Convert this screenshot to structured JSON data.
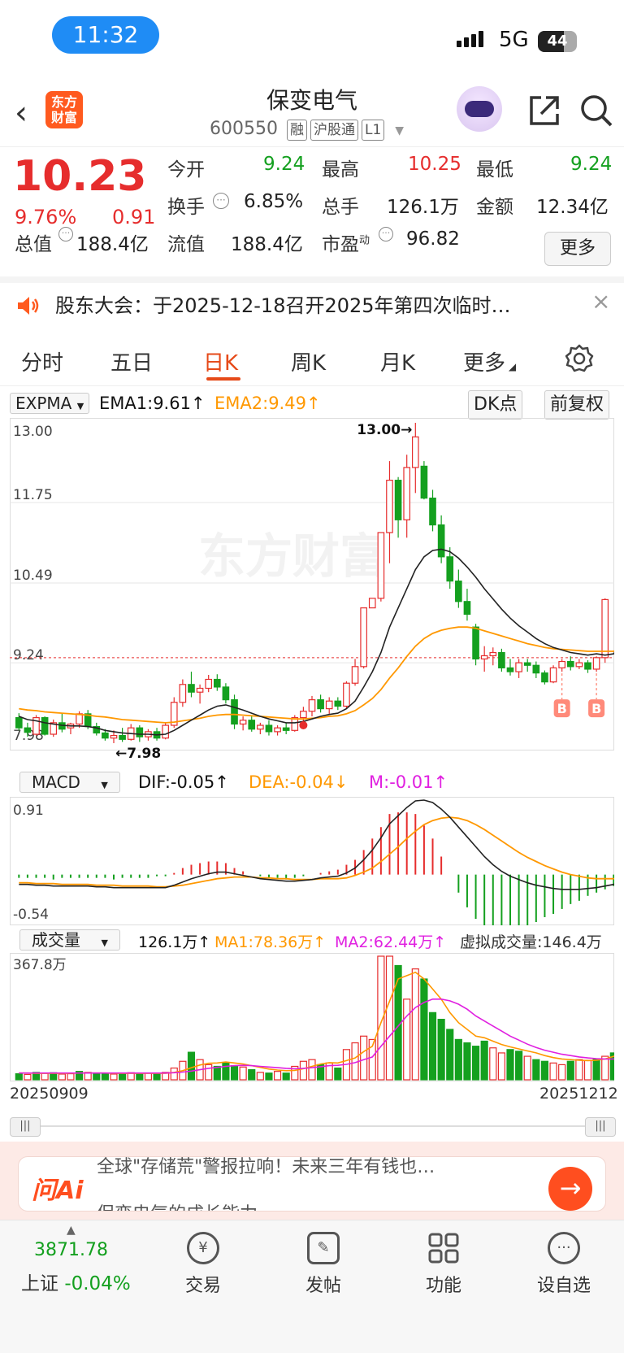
{
  "status": {
    "time": "11:32",
    "network": "5G",
    "battery": "44"
  },
  "header": {
    "stock_name": "保变电气",
    "stock_code": "600550",
    "tags": [
      "融",
      "沪股通",
      "L1"
    ],
    "logo_text": "东方财富"
  },
  "quote": {
    "price": "10.23",
    "pct_change": "9.76%",
    "change": "0.91",
    "open_label": "今开",
    "open": "9.24",
    "high_label": "最高",
    "high": "10.25",
    "low_label": "最低",
    "low": "9.24",
    "turnover_label": "换手",
    "turnover": "6.85%",
    "volume_label": "总手",
    "volume": "126.1万",
    "amount_label": "金额",
    "amount": "12.34亿",
    "total_cap_label": "总值",
    "total_cap": "188.4亿",
    "float_cap_label": "流值",
    "float_cap": "188.4亿",
    "pe_label": "市盈",
    "pe_sup": "动",
    "pe": "96.82",
    "more_label": "更多"
  },
  "notice": {
    "text": "股东大会：于2025-12-18召开2025年第四次临时…"
  },
  "tabs": [
    "分时",
    "五日",
    "日K",
    "周K",
    "月K",
    "更多"
  ],
  "active_tab": "日K",
  "main_indicator": {
    "name": "EXPMA",
    "ema1": "EMA1:9.61",
    "ema2": "EMA2:9.49",
    "dk_label": "DK点",
    "adjust_label": "前复权"
  },
  "macd_indicator": {
    "name": "MACD",
    "dif": "DIF:-0.05",
    "dea": "DEA:-0.04",
    "m": "M:-0.01"
  },
  "vol_indicator": {
    "name": "成交量",
    "vol": "126.1万",
    "ma1": "MA1:78.36万",
    "ma2": "MA2:62.44万",
    "virtual": "虚拟成交量:146.4万"
  },
  "chart_data": {
    "type": "candlestick",
    "start_date": "20250909",
    "end_date": "20251212",
    "price_axis": {
      "ticks": [
        "13.00",
        "11.75",
        "10.49",
        "9.24",
        "7.98"
      ],
      "ylim": [
        7.98,
        13.0
      ]
    },
    "high_marker": "13.00",
    "low_marker": "7.98",
    "watermark": "东方财富",
    "buy_signal_label": "B",
    "candles": [
      {
        "o": 8.38,
        "h": 8.45,
        "l": 8.18,
        "c": 8.22
      },
      {
        "o": 8.22,
        "h": 8.3,
        "l": 8.08,
        "c": 8.15
      },
      {
        "o": 8.12,
        "h": 8.42,
        "l": 8.1,
        "c": 8.38
      },
      {
        "o": 8.38,
        "h": 8.4,
        "l": 8.1,
        "c": 8.12
      },
      {
        "o": 8.12,
        "h": 8.35,
        "l": 8.08,
        "c": 8.3
      },
      {
        "o": 8.3,
        "h": 8.45,
        "l": 8.15,
        "c": 8.2
      },
      {
        "o": 8.22,
        "h": 8.3,
        "l": 8.12,
        "c": 8.28
      },
      {
        "o": 8.28,
        "h": 8.48,
        "l": 8.22,
        "c": 8.44
      },
      {
        "o": 8.44,
        "h": 8.5,
        "l": 8.2,
        "c": 8.24
      },
      {
        "o": 8.24,
        "h": 8.3,
        "l": 8.1,
        "c": 8.14
      },
      {
        "o": 8.14,
        "h": 8.2,
        "l": 8.02,
        "c": 8.06
      },
      {
        "o": 8.06,
        "h": 8.18,
        "l": 7.98,
        "c": 8.1
      },
      {
        "o": 8.1,
        "h": 8.22,
        "l": 8.0,
        "c": 8.04
      },
      {
        "o": 8.04,
        "h": 8.28,
        "l": 8.02,
        "c": 8.22
      },
      {
        "o": 8.22,
        "h": 8.26,
        "l": 8.0,
        "c": 8.08
      },
      {
        "o": 8.08,
        "h": 8.2,
        "l": 8.02,
        "c": 8.16
      },
      {
        "o": 8.16,
        "h": 8.22,
        "l": 8.02,
        "c": 8.06
      },
      {
        "o": 8.06,
        "h": 8.3,
        "l": 8.04,
        "c": 8.26
      },
      {
        "o": 8.26,
        "h": 8.7,
        "l": 8.22,
        "c": 8.62
      },
      {
        "o": 8.62,
        "h": 8.98,
        "l": 8.55,
        "c": 8.9
      },
      {
        "o": 8.9,
        "h": 9.1,
        "l": 8.7,
        "c": 8.78
      },
      {
        "o": 8.78,
        "h": 8.9,
        "l": 8.6,
        "c": 8.84
      },
      {
        "o": 8.84,
        "h": 9.05,
        "l": 8.78,
        "c": 8.98
      },
      {
        "o": 8.98,
        "h": 9.06,
        "l": 8.8,
        "c": 8.86
      },
      {
        "o": 8.86,
        "h": 8.92,
        "l": 8.6,
        "c": 8.66
      },
      {
        "o": 8.66,
        "h": 8.74,
        "l": 8.2,
        "c": 8.28
      },
      {
        "o": 8.28,
        "h": 8.4,
        "l": 8.18,
        "c": 8.34
      },
      {
        "o": 8.34,
        "h": 8.42,
        "l": 8.16,
        "c": 8.2
      },
      {
        "o": 8.2,
        "h": 8.3,
        "l": 8.12,
        "c": 8.26
      },
      {
        "o": 8.26,
        "h": 8.34,
        "l": 8.1,
        "c": 8.16
      },
      {
        "o": 8.16,
        "h": 8.26,
        "l": 8.1,
        "c": 8.22
      },
      {
        "o": 8.22,
        "h": 8.3,
        "l": 8.12,
        "c": 8.18
      },
      {
        "o": 8.18,
        "h": 8.42,
        "l": 8.16,
        "c": 8.38
      },
      {
        "o": 8.38,
        "h": 8.55,
        "l": 8.32,
        "c": 8.48
      },
      {
        "o": 8.48,
        "h": 8.72,
        "l": 8.4,
        "c": 8.66
      },
      {
        "o": 8.66,
        "h": 8.74,
        "l": 8.46,
        "c": 8.52
      },
      {
        "o": 8.52,
        "h": 8.7,
        "l": 8.44,
        "c": 8.64
      },
      {
        "o": 8.64,
        "h": 8.7,
        "l": 8.5,
        "c": 8.56
      },
      {
        "o": 8.56,
        "h": 8.95,
        "l": 8.52,
        "c": 8.92
      },
      {
        "o": 8.92,
        "h": 9.3,
        "l": 8.88,
        "c": 9.18
      },
      {
        "o": 9.18,
        "h": 10.1,
        "l": 9.15,
        "c": 10.1
      },
      {
        "o": 10.1,
        "h": 10.25,
        "l": 10.1,
        "c": 10.25
      },
      {
        "o": 10.25,
        "h": 11.28,
        "l": 10.2,
        "c": 11.28
      },
      {
        "o": 11.28,
        "h": 12.4,
        "l": 10.8,
        "c": 12.1
      },
      {
        "o": 12.1,
        "h": 12.15,
        "l": 11.2,
        "c": 11.48
      },
      {
        "o": 11.48,
        "h": 12.5,
        "l": 11.2,
        "c": 12.3
      },
      {
        "o": 12.3,
        "h": 13.0,
        "l": 11.9,
        "c": 12.78
      },
      {
        "o": 12.32,
        "h": 12.4,
        "l": 11.8,
        "c": 11.82
      },
      {
        "o": 11.82,
        "h": 11.95,
        "l": 11.3,
        "c": 11.4
      },
      {
        "o": 11.4,
        "h": 11.55,
        "l": 10.8,
        "c": 10.9
      },
      {
        "o": 10.9,
        "h": 11.05,
        "l": 10.4,
        "c": 10.52
      },
      {
        "o": 10.52,
        "h": 10.7,
        "l": 10.1,
        "c": 10.2
      },
      {
        "o": 10.2,
        "h": 10.4,
        "l": 9.9,
        "c": 10.0
      },
      {
        "o": 9.8,
        "h": 9.85,
        "l": 9.2,
        "c": 9.3
      },
      {
        "o": 9.3,
        "h": 9.5,
        "l": 9.1,
        "c": 9.35
      },
      {
        "o": 9.35,
        "h": 9.48,
        "l": 9.2,
        "c": 9.4
      },
      {
        "o": 9.4,
        "h": 9.46,
        "l": 9.1,
        "c": 9.16
      },
      {
        "o": 9.16,
        "h": 9.3,
        "l": 9.04,
        "c": 9.1
      },
      {
        "o": 9.1,
        "h": 9.3,
        "l": 9.0,
        "c": 9.24
      },
      {
        "o": 9.24,
        "h": 9.3,
        "l": 9.1,
        "c": 9.2
      },
      {
        "o": 9.2,
        "h": 9.26,
        "l": 9.0,
        "c": 9.08
      },
      {
        "o": 9.08,
        "h": 9.12,
        "l": 8.9,
        "c": 8.94
      },
      {
        "o": 8.94,
        "h": 9.2,
        "l": 8.92,
        "c": 9.16
      },
      {
        "o": 9.16,
        "h": 9.3,
        "l": 9.1,
        "c": 9.26
      },
      {
        "o": 9.26,
        "h": 9.34,
        "l": 9.12,
        "c": 9.18
      },
      {
        "o": 9.18,
        "h": 9.3,
        "l": 9.14,
        "c": 9.24
      },
      {
        "o": 9.24,
        "h": 9.28,
        "l": 9.08,
        "c": 9.14
      },
      {
        "o": 9.14,
        "h": 9.34,
        "l": 9.1,
        "c": 9.32
      },
      {
        "o": 9.32,
        "h": 10.25,
        "l": 9.24,
        "c": 10.23
      }
    ],
    "ema1": [
      8.4,
      8.35,
      8.33,
      8.3,
      8.28,
      8.26,
      8.25,
      8.25,
      8.24,
      8.22,
      8.18,
      8.16,
      8.14,
      8.13,
      8.12,
      8.12,
      8.11,
      8.12,
      8.18,
      8.26,
      8.34,
      8.42,
      8.5,
      8.56,
      8.58,
      8.54,
      8.5,
      8.45,
      8.4,
      8.36,
      8.33,
      8.3,
      8.3,
      8.32,
      8.36,
      8.4,
      8.43,
      8.45,
      8.52,
      8.64,
      8.86,
      9.1,
      9.4,
      9.8,
      10.1,
      10.4,
      10.7,
      10.9,
      11.0,
      11.02,
      10.98,
      10.88,
      10.74,
      10.58,
      10.4,
      10.24,
      10.08,
      9.94,
      9.82,
      9.72,
      9.62,
      9.54,
      9.48,
      9.44,
      9.4,
      9.38,
      9.36,
      9.38,
      9.36,
      9.38,
      9.61
    ],
    "ema2": [
      8.52,
      8.5,
      8.49,
      8.47,
      8.46,
      8.45,
      8.44,
      8.43,
      8.42,
      8.4,
      8.39,
      8.37,
      8.35,
      8.34,
      8.33,
      8.32,
      8.31,
      8.3,
      8.31,
      8.33,
      8.35,
      8.37,
      8.4,
      8.42,
      8.43,
      8.43,
      8.42,
      8.41,
      8.4,
      8.39,
      8.38,
      8.37,
      8.36,
      8.36,
      8.37,
      8.38,
      8.4,
      8.41,
      8.44,
      8.49,
      8.58,
      8.68,
      8.82,
      9.0,
      9.16,
      9.34,
      9.5,
      9.62,
      9.7,
      9.75,
      9.78,
      9.8,
      9.8,
      9.78,
      9.74,
      9.7,
      9.66,
      9.62,
      9.58,
      9.54,
      9.51,
      9.48,
      9.46,
      9.45,
      9.44,
      9.43,
      9.42,
      9.42,
      9.42,
      9.42,
      9.49
    ],
    "buy_signals": [
      63,
      67
    ],
    "red_dot_index": 33,
    "macd": {
      "axis_ticks": [
        "0.91",
        "-0.54"
      ],
      "ylim": [
        -0.54,
        0.91
      ],
      "dif": [
        -0.12,
        -0.12,
        -0.13,
        -0.13,
        -0.14,
        -0.14,
        -0.14,
        -0.14,
        -0.14,
        -0.15,
        -0.15,
        -0.16,
        -0.16,
        -0.16,
        -0.16,
        -0.16,
        -0.16,
        -0.16,
        -0.13,
        -0.09,
        -0.05,
        -0.02,
        0.01,
        0.03,
        0.03,
        0.01,
        -0.01,
        -0.03,
        -0.05,
        -0.06,
        -0.07,
        -0.08,
        -0.08,
        -0.07,
        -0.06,
        -0.04,
        -0.03,
        -0.02,
        0.02,
        0.08,
        0.18,
        0.3,
        0.45,
        0.62,
        0.72,
        0.82,
        0.9,
        0.91,
        0.88,
        0.8,
        0.7,
        0.58,
        0.46,
        0.34,
        0.22,
        0.12,
        0.04,
        -0.02,
        -0.06,
        -0.1,
        -0.13,
        -0.15,
        -0.17,
        -0.18,
        -0.18,
        -0.18,
        -0.17,
        -0.16,
        -0.14,
        -0.12,
        -0.05
      ],
      "dea": [
        -0.1,
        -0.1,
        -0.11,
        -0.11,
        -0.11,
        -0.12,
        -0.12,
        -0.12,
        -0.12,
        -0.13,
        -0.13,
        -0.13,
        -0.14,
        -0.14,
        -0.14,
        -0.14,
        -0.15,
        -0.15,
        -0.14,
        -0.13,
        -0.11,
        -0.09,
        -0.07,
        -0.05,
        -0.04,
        -0.03,
        -0.03,
        -0.03,
        -0.04,
        -0.04,
        -0.05,
        -0.05,
        -0.06,
        -0.06,
        -0.06,
        -0.05,
        -0.05,
        -0.05,
        -0.04,
        -0.01,
        0.03,
        0.08,
        0.16,
        0.25,
        0.34,
        0.44,
        0.53,
        0.61,
        0.66,
        0.69,
        0.7,
        0.69,
        0.66,
        0.61,
        0.55,
        0.48,
        0.41,
        0.34,
        0.27,
        0.21,
        0.16,
        0.11,
        0.07,
        0.03,
        0.0,
        -0.02,
        -0.04,
        -0.05,
        -0.05,
        -0.05,
        -0.04
      ]
    },
    "volume": {
      "axis_top": "367.8万",
      "max": 367.8,
      "bars": [
        18,
        16,
        22,
        19,
        21,
        17,
        18,
        25,
        22,
        18,
        20,
        17,
        19,
        21,
        18,
        20,
        17,
        22,
        35,
        55,
        82,
        60,
        45,
        40,
        50,
        42,
        38,
        30,
        22,
        20,
        25,
        20,
        40,
        55,
        60,
        45,
        50,
        35,
        90,
        110,
        130,
        120,
        367.8,
        367.8,
        340,
        240,
        330,
        300,
        200,
        180,
        150,
        120,
        110,
        100,
        115,
        95,
        80,
        90,
        85,
        70,
        60,
        55,
        50,
        45,
        55,
        60,
        58,
        62,
        70,
        80,
        146.4
      ],
      "ma1": [
        20,
        20,
        19,
        19,
        19,
        19,
        19,
        20,
        20,
        20,
        20,
        19,
        19,
        19,
        19,
        19,
        19,
        19,
        22,
        27,
        36,
        44,
        49,
        50,
        53,
        50,
        47,
        42,
        37,
        32,
        29,
        27,
        28,
        33,
        40,
        47,
        51,
        50,
        57,
        65,
        84,
        100,
        170,
        234,
        300,
        310,
        320,
        300,
        270,
        240,
        200,
        170,
        150,
        130,
        125,
        115,
        105,
        98,
        92,
        86,
        80,
        72,
        66,
        62,
        60,
        58,
        57,
        58,
        62,
        70,
        78.36
      ],
      "ma2": [
        20,
        20,
        20,
        20,
        20,
        20,
        20,
        20,
        20,
        20,
        20,
        20,
        20,
        20,
        20,
        20,
        20,
        20,
        21,
        23,
        26,
        30,
        34,
        37,
        40,
        42,
        43,
        42,
        40,
        38,
        36,
        34,
        33,
        34,
        36,
        39,
        42,
        43,
        46,
        51,
        60,
        68,
        100,
        130,
        160,
        190,
        215,
        230,
        240,
        240,
        235,
        225,
        210,
        190,
        175,
        160,
        145,
        130,
        118,
        106,
        96,
        88,
        82,
        76,
        72,
        68,
        65,
        63,
        62,
        62,
        62.44
      ],
      "up_flags": [
        0,
        1,
        0,
        1,
        0,
        1,
        1,
        0,
        1,
        0,
        0,
        1,
        0,
        1,
        0,
        1,
        0,
        1,
        1,
        1,
        0,
        1,
        1,
        0,
        0,
        0,
        1,
        0,
        1,
        0,
        1,
        0,
        1,
        1,
        1,
        0,
        1,
        0,
        1,
        1,
        1,
        1,
        1,
        1,
        0,
        1,
        1,
        0,
        0,
        0,
        0,
        0,
        0,
        0,
        0,
        1,
        1,
        0,
        0,
        1,
        0,
        0,
        1,
        1,
        0,
        1,
        1,
        0,
        1,
        0,
        1
      ]
    }
  },
  "scroll": {
    "left_handle": "|||",
    "right_handle": "|||"
  },
  "ai_bar": {
    "logo": "问Ai",
    "text": "全球\"存储荒\"警报拉响！未来三年有钱也…",
    "text2": "保变电气的成长能力"
  },
  "bottom_nav": {
    "index_value": "3871.78",
    "index_name": "上证",
    "index_pct": "-0.04%",
    "items": [
      "交易",
      "发帖",
      "功能",
      "设自选"
    ]
  },
  "colors": {
    "up": "#e62d2d",
    "down": "#14a01f",
    "accent": "#e64a19",
    "ema2": "#ff9800",
    "ma2": "#e020e0"
  }
}
